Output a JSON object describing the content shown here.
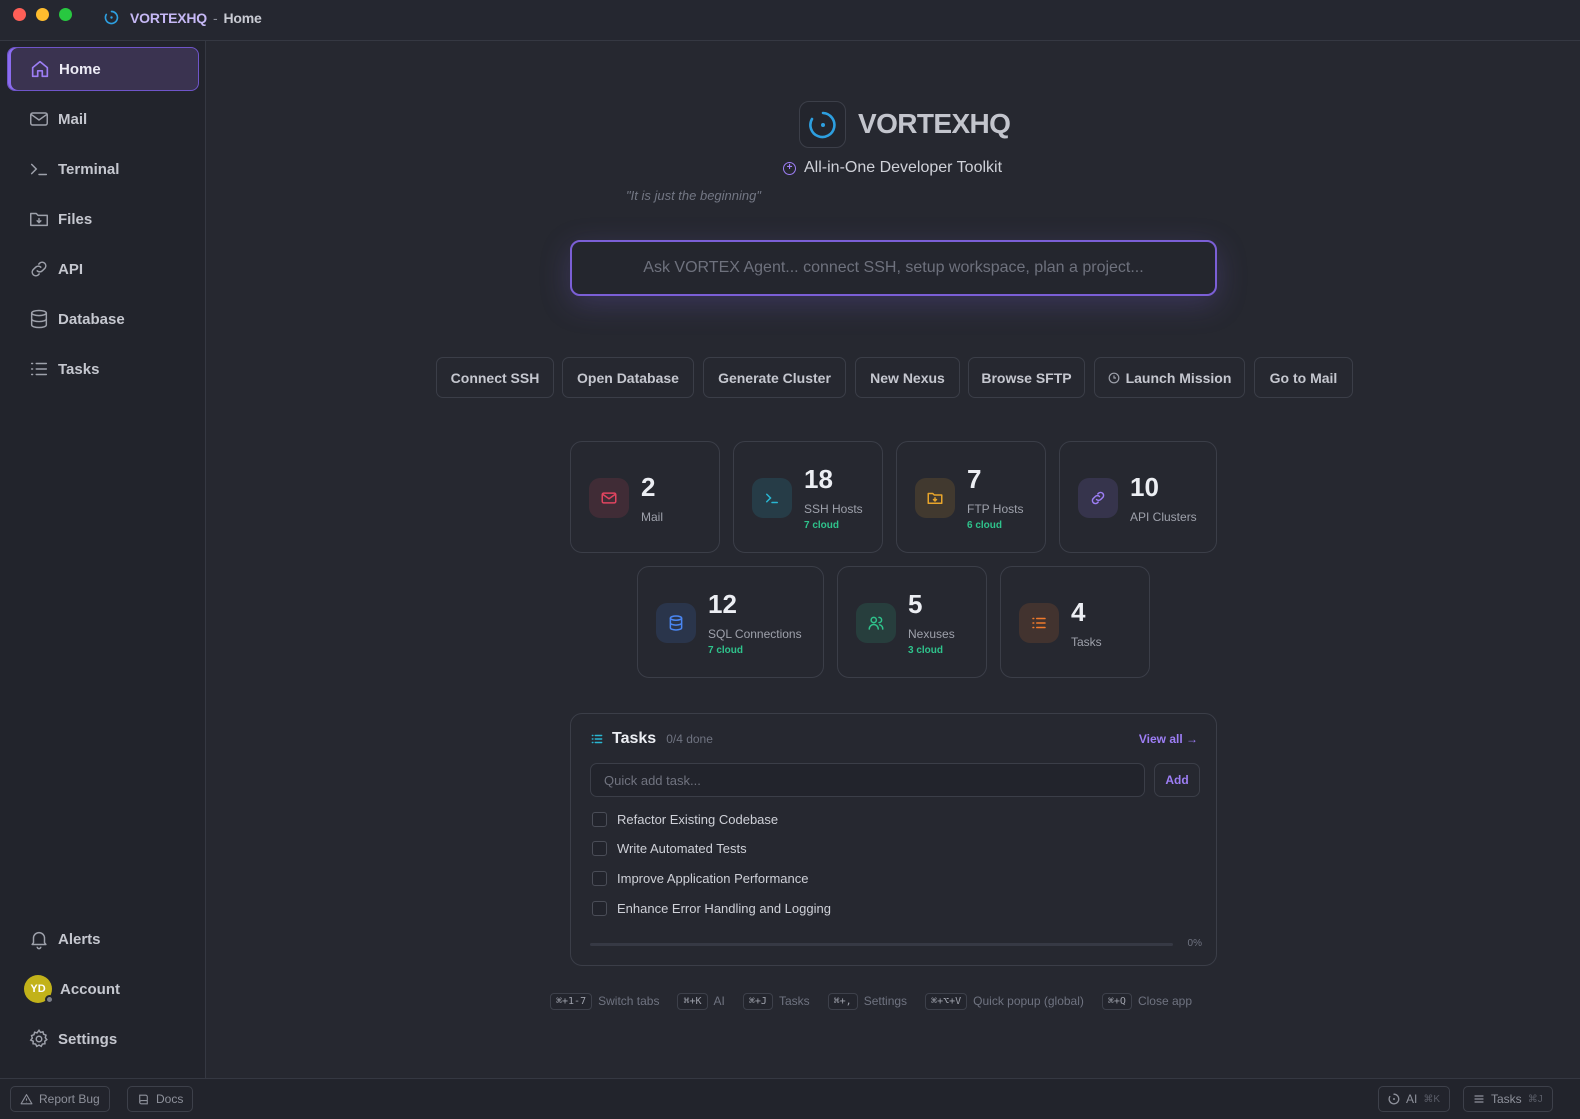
{
  "window": {
    "brand": "VORTEXHQ",
    "separator": "-",
    "page": "Home"
  },
  "sidebar": {
    "items": [
      {
        "label": "Home",
        "icon": "home-icon"
      },
      {
        "label": "Mail",
        "icon": "mail-icon"
      },
      {
        "label": "Terminal",
        "icon": "terminal-icon"
      },
      {
        "label": "Files",
        "icon": "folder-icon"
      },
      {
        "label": "API",
        "icon": "link-icon"
      },
      {
        "label": "Database",
        "icon": "database-icon"
      },
      {
        "label": "Tasks",
        "icon": "list-icon"
      }
    ],
    "bottom": {
      "alerts": "Alerts",
      "account": "Account",
      "avatar_initials": "YD",
      "settings": "Settings"
    }
  },
  "hero": {
    "logo_text": "VORTEXHQ",
    "subtitle": "All-in-One Developer Toolkit",
    "tagline": "\"It is just the beginning\"",
    "ask_placeholder": "Ask VORTEX Agent... connect SSH, setup workspace, plan a project..."
  },
  "quick_actions": [
    "Connect SSH",
    "Open Database",
    "Generate Cluster",
    "New Nexus",
    "Browse SFTP",
    "Launch Mission",
    "Go to Mail"
  ],
  "stats": [
    {
      "value": "2",
      "label": "Mail",
      "sub": "",
      "color": "#e0445f",
      "icon": "mail-icon"
    },
    {
      "value": "18",
      "label": "SSH Hosts",
      "sub": "7 cloud",
      "color": "#29b6d2",
      "icon": "terminal-icon"
    },
    {
      "value": "7",
      "label": "FTP Hosts",
      "sub": "6 cloud",
      "color": "#e8a52b",
      "icon": "folder-download-icon"
    },
    {
      "value": "10",
      "label": "API Clusters",
      "sub": "",
      "color": "#9d7ef5",
      "icon": "link-icon"
    },
    {
      "value": "12",
      "label": "SQL Connections",
      "sub": "7 cloud",
      "color": "#4a86f2",
      "icon": "database-icon"
    },
    {
      "value": "5",
      "label": "Nexuses",
      "sub": "3 cloud",
      "color": "#2fc38c",
      "icon": "users-icon"
    },
    {
      "value": "4",
      "label": "Tasks",
      "sub": "",
      "color": "#f07a2b",
      "icon": "list-icon"
    }
  ],
  "tasks": {
    "title": "Tasks",
    "count": "0/4 done",
    "view_all": "View all →",
    "input_placeholder": "Quick add task...",
    "add_label": "Add",
    "items": [
      "Refactor Existing Codebase",
      "Write Automated Tests",
      "Improve Application Performance",
      "Enhance Error Handling and Logging"
    ],
    "progress_percent": 0,
    "progress_text": "0%"
  },
  "shortcuts": [
    {
      "key": "⌘+1-7",
      "label": "Switch tabs"
    },
    {
      "key": "⌘+K",
      "label": "AI"
    },
    {
      "key": "⌘+J",
      "label": "Tasks"
    },
    {
      "key": "⌘+,",
      "label": "Settings"
    },
    {
      "key": "⌘+⌥+V",
      "label": "Quick popup (global)"
    },
    {
      "key": "⌘+Q",
      "label": "Close app"
    }
  ],
  "statusbar": {
    "report_bug": "Report Bug",
    "docs": "Docs",
    "ai": "AI",
    "ai_key": "⌘K",
    "tasks": "Tasks",
    "tasks_key": "⌘J"
  },
  "colors": {
    "accent": "#8b6cf0",
    "background": "#262830",
    "sidebar": "#22242c"
  }
}
